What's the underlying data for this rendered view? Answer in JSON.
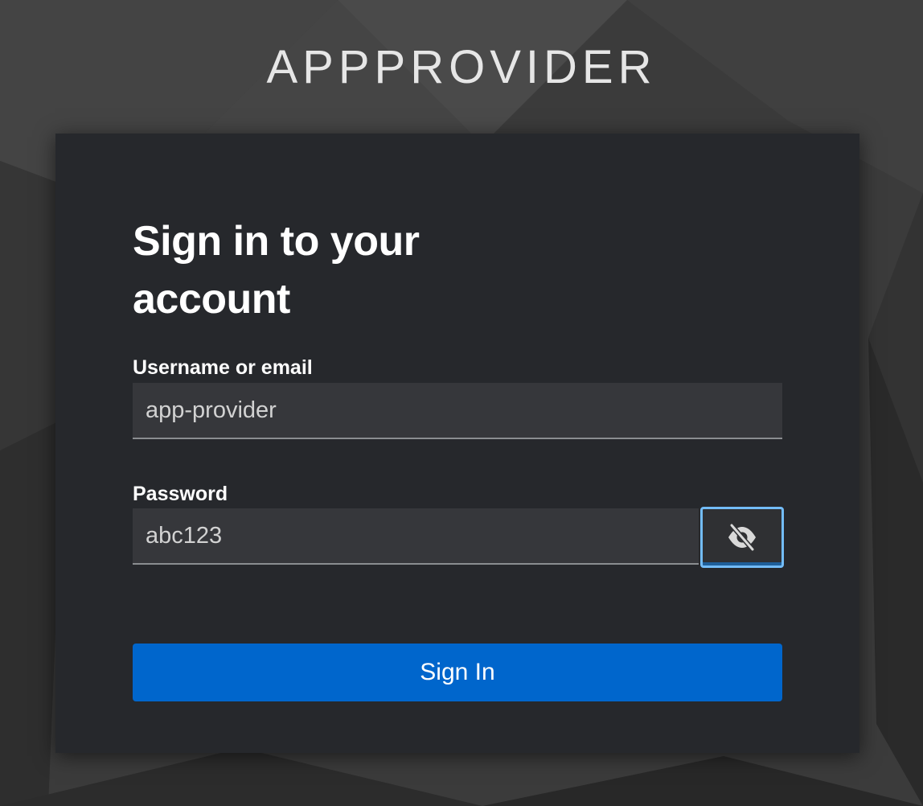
{
  "brand": {
    "name": "APPPROVIDER"
  },
  "login": {
    "title": "Sign in to your account",
    "username_label": "Username or email",
    "username_value": "app-provider",
    "password_label": "Password",
    "password_value": "abc123",
    "toggle_icon": "eye-slash-icon",
    "submit_label": "Sign In"
  },
  "colors": {
    "card_bg": "#26282c",
    "input_bg": "#36373b",
    "primary": "#0066cc",
    "focus": "#73bcf7"
  }
}
